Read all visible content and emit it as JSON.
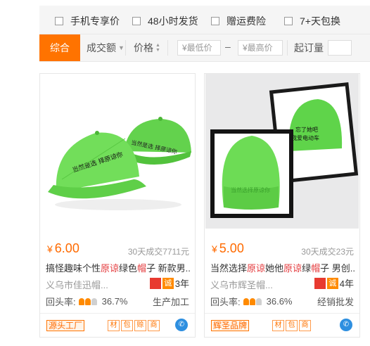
{
  "filters": [
    {
      "label": "手机专享价"
    },
    {
      "label": "48小时发货"
    },
    {
      "label": "赠运费险"
    },
    {
      "label": "7+天包换"
    }
  ],
  "sort": {
    "active": "综合",
    "sales": "成交额",
    "price": "价格",
    "price_min_placeholder": "¥最低价",
    "price_max_placeholder": "¥最高价",
    "dash": "–",
    "order_label": "起订量"
  },
  "products": [
    {
      "currency": "¥",
      "price": "6.00",
      "sales": "30天成交7711元",
      "title_parts": [
        "搞怪趣味个性",
        "原谅",
        "绿色",
        "帽",
        "子 新款男..."
      ],
      "shop": "义乌市佳迅帽...",
      "cheng": "诚",
      "years": "3年",
      "repeat_label": "回头率:",
      "repeat_rate": "36.7%",
      "biz_type": "生产加工",
      "tag": "源头工厂",
      "mini_tags": [
        "材",
        "包",
        "赊",
        "商"
      ],
      "image": "two-green-caps"
    },
    {
      "currency": "¥",
      "price": "5.00",
      "sales": "30天成交23元",
      "title_parts": [
        "当然选择",
        "原谅",
        "她他",
        "原谅",
        "绿",
        "帽",
        "子 男创..."
      ],
      "shop": "义乌市辉圣帽...",
      "cheng": "诚",
      "years": "4年",
      "repeat_label": "回头率:",
      "repeat_rate": "36.6%",
      "biz_type": "经销批发",
      "tag": "辉圣品牌",
      "mini_tags": [
        "材",
        "包",
        "商"
      ],
      "image": "green-beanie-frames"
    }
  ],
  "colors": {
    "accent": "#ff7300",
    "price": "#ff6a00",
    "highlight": "#e4393c",
    "cap_green": "#6ddc55"
  }
}
